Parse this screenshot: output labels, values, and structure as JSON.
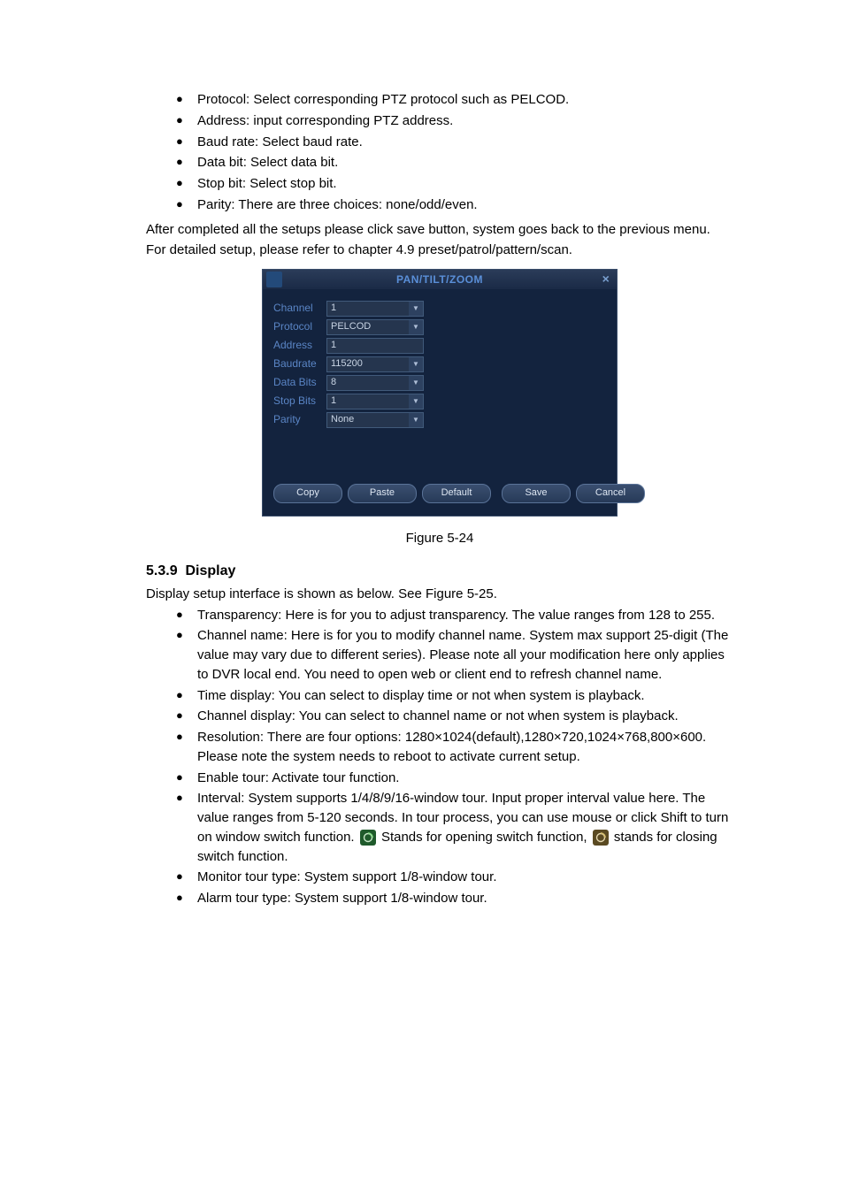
{
  "top_list": [
    "Protocol: Select corresponding PTZ protocol such as PELCOD.",
    "Address: input corresponding PTZ address.",
    "Baud rate: Select baud rate.",
    "Data bit: Select data bit.",
    "Stop bit: Select stop bit.",
    "Parity: There are three choices: none/odd/even."
  ],
  "after1": "After completed all the setups please click save button, system goes back to the previous menu.",
  "after2": "For detailed setup, please refer to chapter 4.9 preset/patrol/pattern/scan.",
  "dialog": {
    "title": "PAN/TILT/ZOOM",
    "fields": {
      "channel": {
        "label": "Channel",
        "value": "1"
      },
      "protocol": {
        "label": "Protocol",
        "value": "PELCOD"
      },
      "address": {
        "label": "Address",
        "value": "1"
      },
      "baudrate": {
        "label": "Baudrate",
        "value": "115200"
      },
      "databits": {
        "label": "Data Bits",
        "value": "8"
      },
      "stopbits": {
        "label": "Stop Bits",
        "value": "1"
      },
      "parity": {
        "label": "Parity",
        "value": "None"
      }
    },
    "buttons": {
      "copy": "Copy",
      "paste": "Paste",
      "default": "Default",
      "save": "Save",
      "cancel": "Cancel"
    }
  },
  "figure_caption": "Figure 5-24",
  "section": {
    "num": "5.3.9",
    "title": "Display"
  },
  "display_intro": "Display setup interface is shown as below. See Figure 5-25.",
  "display_list": {
    "i0": "Transparency: Here is for you to adjust transparency. The value ranges from 128 to 255.",
    "i1": "Channel name: Here is for you to modify channel name. System max support 25-digit (The value may vary due to different series). Please note all your modification here only applies to DVR local end. You need to open web or client end to refresh channel name.",
    "i2": "Time display: You can select to display time or not when system is playback.",
    "i3": "Channel display: You can select to channel name or not when system is playback.",
    "i4": "Resolution: There are four options: 1280×1024(default),1280×720,1024×768,800×600. Please note the system needs to reboot to activate current setup.",
    "i5": "Enable tour: Activate tour function.",
    "i6a": "Interval: System supports 1/4/8/9/16-window tour. Input proper interval value here. The value ranges from 5-120 seconds. In tour process, you can use mouse or click Shift to turn on window switch function. ",
    "i6b": " Stands for opening switch function, ",
    "i6c": " stands for closing switch function.",
    "i7": "Monitor tour type: System support 1/8-window tour.",
    "i8": "Alarm tour type: System support 1/8-window tour."
  }
}
